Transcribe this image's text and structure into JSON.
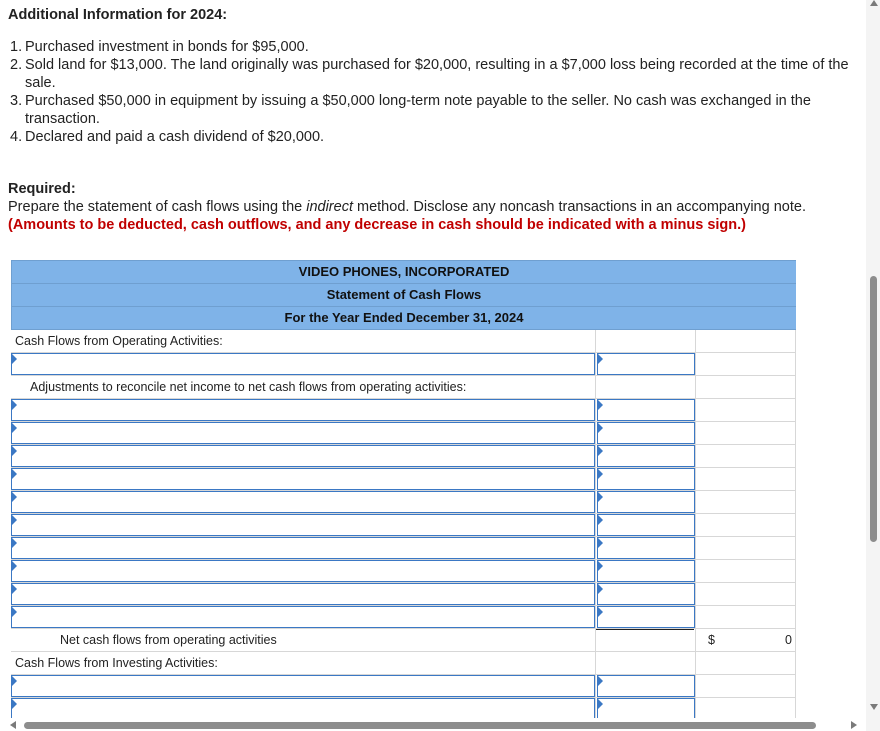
{
  "additional_info_title": "Additional Information for 2024:",
  "info_items": [
    {
      "num": "1.",
      "text": "Purchased investment in bonds for $95,000."
    },
    {
      "num": "2.",
      "text": "Sold land for $13,000. The land originally was purchased for $20,000, resulting in a $7,000 loss being recorded at the time of the sale."
    },
    {
      "num": "3.",
      "text": "Purchased $50,000 in equipment by issuing a $50,000 long-term note payable to the seller. No cash was exchanged in the transaction."
    },
    {
      "num": "4.",
      "text": "Declared and paid a cash dividend of $20,000."
    }
  ],
  "required": {
    "title": "Required:",
    "text_before": "Prepare the statement of cash flows using the ",
    "text_italic": "indirect",
    "text_after": " method. Disclose any noncash transactions in an accompanying note. ",
    "red_note": "(Amounts to be deducted, cash outflows, and any decrease in cash should be indicated with a minus sign.)"
  },
  "statement": {
    "company": "VIDEO PHONES, INCORPORATED",
    "title": "Statement of Cash Flows",
    "period": "For the Year Ended December 31, 2024",
    "operating_heading": "Cash Flows from Operating Activities:",
    "adjustments_heading": "Adjustments to reconcile net income to net cash flows from operating activities:",
    "net_operating_label": "Net cash flows from operating activities",
    "net_operating_currency": "$",
    "net_operating_value": "0",
    "investing_heading": "Cash Flows from Investing Activities:"
  },
  "colors": {
    "header_bg": "#7fb3e8",
    "input_border": "#3b78c4",
    "note_red": "#c00000"
  }
}
